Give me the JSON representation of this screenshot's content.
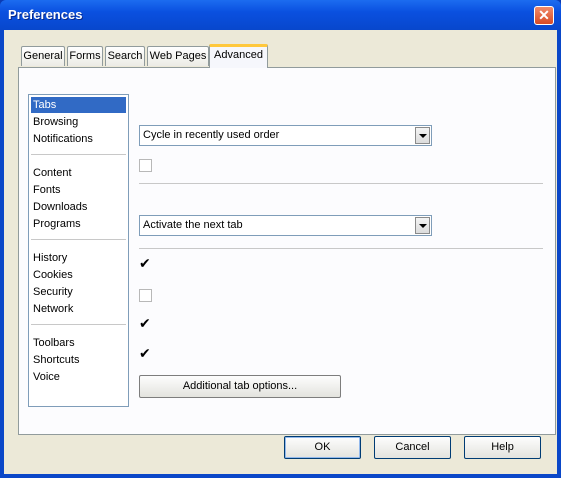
{
  "window": {
    "title": "Preferences"
  },
  "tabs": [
    {
      "label": "General",
      "active": false
    },
    {
      "label": "Forms",
      "active": false
    },
    {
      "label": "Search",
      "active": false
    },
    {
      "label": "Web Pages",
      "active": false
    },
    {
      "label": "Advanced",
      "active": true
    }
  ],
  "categories": {
    "selected": "Tabs",
    "groups": [
      [
        "Tabs",
        "Browsing",
        "Notifications"
      ],
      [
        "Content",
        "Fonts",
        "Downloads",
        "Programs"
      ],
      [
        "History",
        "Cookies",
        "Security",
        "Network"
      ],
      [
        "Toolbars",
        "Shortcuts",
        "Voice"
      ]
    ]
  },
  "settings": {
    "cycle_select": {
      "value": "Cycle in recently used order"
    },
    "close_select": {
      "value": "Activate the next tab"
    },
    "checkboxes": [
      {
        "checked": false
      },
      {
        "checked": true
      },
      {
        "checked": false
      },
      {
        "checked": true
      },
      {
        "checked": true
      }
    ],
    "additional_button": "Additional tab options..."
  },
  "footer": {
    "ok": "OK",
    "cancel": "Cancel",
    "help": "Help"
  },
  "colors": {
    "title_bar": "#0a50e0",
    "selection": "#316ac5",
    "dialog_face": "#ece9d8"
  }
}
